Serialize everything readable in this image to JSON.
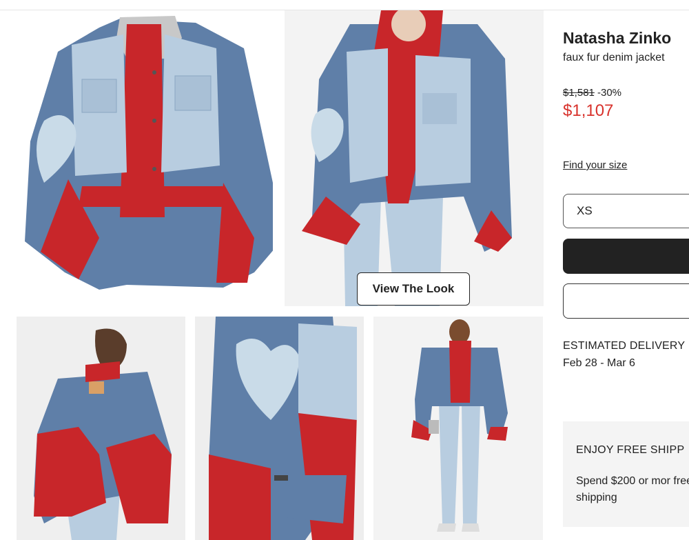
{
  "product": {
    "brand": "Natasha Zinko",
    "name": "faux fur denim jacket",
    "original_price": "$1,581",
    "discount": "-30%",
    "price": "$1,107"
  },
  "gallery": {
    "view_look_label": "View The Look",
    "images": [
      {
        "icon": "jacket-product-image"
      },
      {
        "icon": "model-front-image"
      },
      {
        "icon": "model-back-image"
      },
      {
        "icon": "sleeve-detail-image"
      },
      {
        "icon": "model-full-length-image"
      }
    ]
  },
  "size": {
    "find_size_label": "Find your size",
    "selected": "XS"
  },
  "delivery": {
    "label": "ESTIMATED DELIVERY",
    "dates": "Feb 28 - Mar 6"
  },
  "shipping": {
    "title": "ENJOY FREE SHIPP",
    "text": "Spend $200 or mor free shipping"
  },
  "colors": {
    "sale_red": "#d8322c",
    "button_dark": "#222222",
    "denim": "#5f7fa8",
    "light_denim": "#b8cde0",
    "fur_red": "#d42a2a"
  }
}
